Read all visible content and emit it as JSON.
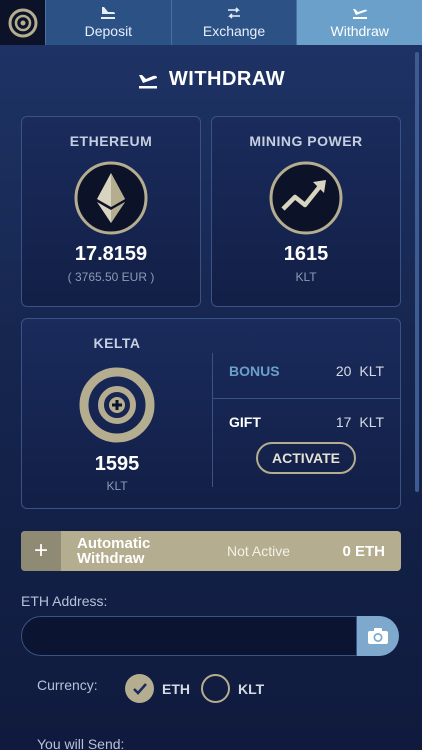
{
  "tabs": [
    {
      "label": "Deposit",
      "icon": "landing-plane-icon"
    },
    {
      "label": "Exchange",
      "icon": "swap-arrows-icon"
    },
    {
      "label": "Withdraw",
      "icon": "takeoff-plane-icon",
      "active": true
    }
  ],
  "page": {
    "title": "WITHDRAW",
    "icon": "takeoff-plane-icon"
  },
  "ethereum": {
    "title": "ETHEREUM",
    "value": "17.8159",
    "fiat": "( 3765.50 EUR )"
  },
  "mining": {
    "title": "MINING POWER",
    "value": "1615",
    "unit": "KLT"
  },
  "kelta": {
    "title": "KELTA",
    "value": "1595",
    "unit": "KLT",
    "bonus_label": "BONUS",
    "bonus_value": "20",
    "bonus_unit": "KLT",
    "gift_label": "GIFT",
    "gift_value": "17",
    "gift_unit": "KLT",
    "activate_label": "ACTIVATE"
  },
  "auto_withdraw": {
    "plus": "+",
    "label": "Automatic Withdraw",
    "status": "Not Active",
    "amount": "0 ETH"
  },
  "eth_address": {
    "label": "ETH Address:",
    "value": "",
    "placeholder": ""
  },
  "currency": {
    "label": "Currency:",
    "options": [
      {
        "label": "ETH",
        "checked": true
      },
      {
        "label": "KLT",
        "checked": false
      }
    ]
  },
  "send": {
    "label": "You will Send:"
  },
  "colors": {
    "accent": "#b5ad8f",
    "tab_active": "#6aa0c9",
    "tab": "#2c5285",
    "bonus": "#6aa0c9"
  }
}
